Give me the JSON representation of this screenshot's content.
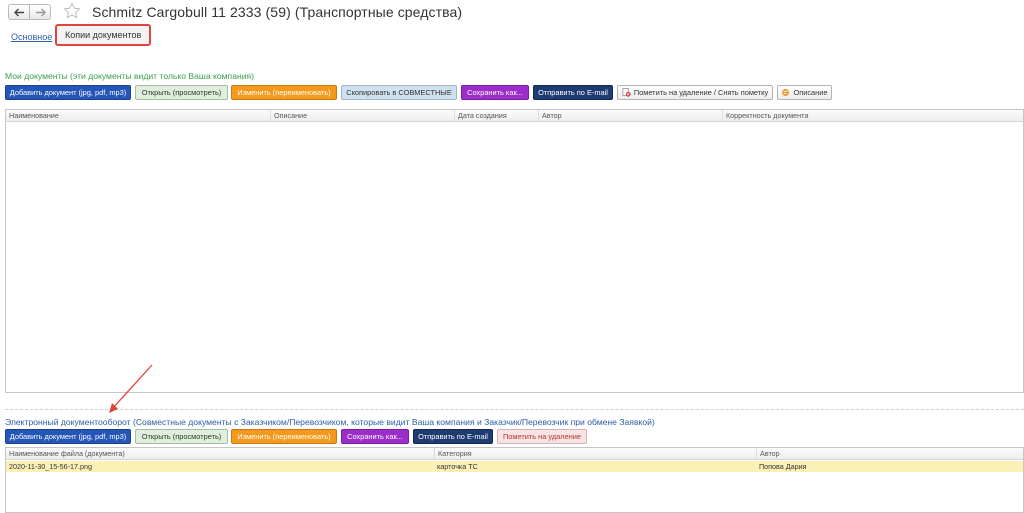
{
  "header": {
    "title": "Schmitz Cargobull 11 2333 (59) (Транспортные средства)",
    "icons": [
      "arrow-left-icon",
      "arrow-right-icon",
      "star-icon"
    ]
  },
  "tabs": [
    {
      "label": "Основное"
    },
    {
      "label": "Копии документов"
    }
  ],
  "my_docs": {
    "title": "Мои документы (эти документы видит только Ваша компания)",
    "buttons": [
      {
        "label": "Добавить документ (jpg, pdf, mp3)"
      },
      {
        "label": "Открыть (просмотреть)"
      },
      {
        "label": "Изменить (переименовать)"
      },
      {
        "label": "Скопировать в СОВМЕСТНЫЕ"
      },
      {
        "label": "Сохранить как..."
      },
      {
        "label": "Отправить по E-mail"
      },
      {
        "label": "Пометить на удаление / Снять пометку"
      },
      {
        "label": "Описание"
      }
    ],
    "columns": [
      "Наименование",
      "Описание",
      "Дата создания",
      "Автор",
      "Корректность документа"
    ]
  },
  "edo": {
    "title": "Электронный документооборот (Совместные документы с Заказчиком/Перевозчиком, которые видит Ваша компания и Заказчик/Перевозчик при обмене Заявкой)",
    "buttons": [
      {
        "label": "Добавить документ (jpg, pdf, mp3)"
      },
      {
        "label": "Открыть (просмотреть)"
      },
      {
        "label": "Изменить (переименовать)"
      },
      {
        "label": "Сохранить как..."
      },
      {
        "label": "Отправить по E-mail"
      },
      {
        "label": "Пометить на удаление"
      }
    ],
    "columns": [
      "Наименование файла (документа)",
      "Категория",
      "Автор"
    ],
    "rows": [
      {
        "file": "2020-11-30_15-56-17.png",
        "category": "карточка ТС",
        "author": "Попова Дария"
      }
    ]
  },
  "colors": {
    "link": "#2b5ea6",
    "section_green": "#3aa04a",
    "highlight_box": "#e0443c",
    "selected_row": "#fbf1b6"
  }
}
